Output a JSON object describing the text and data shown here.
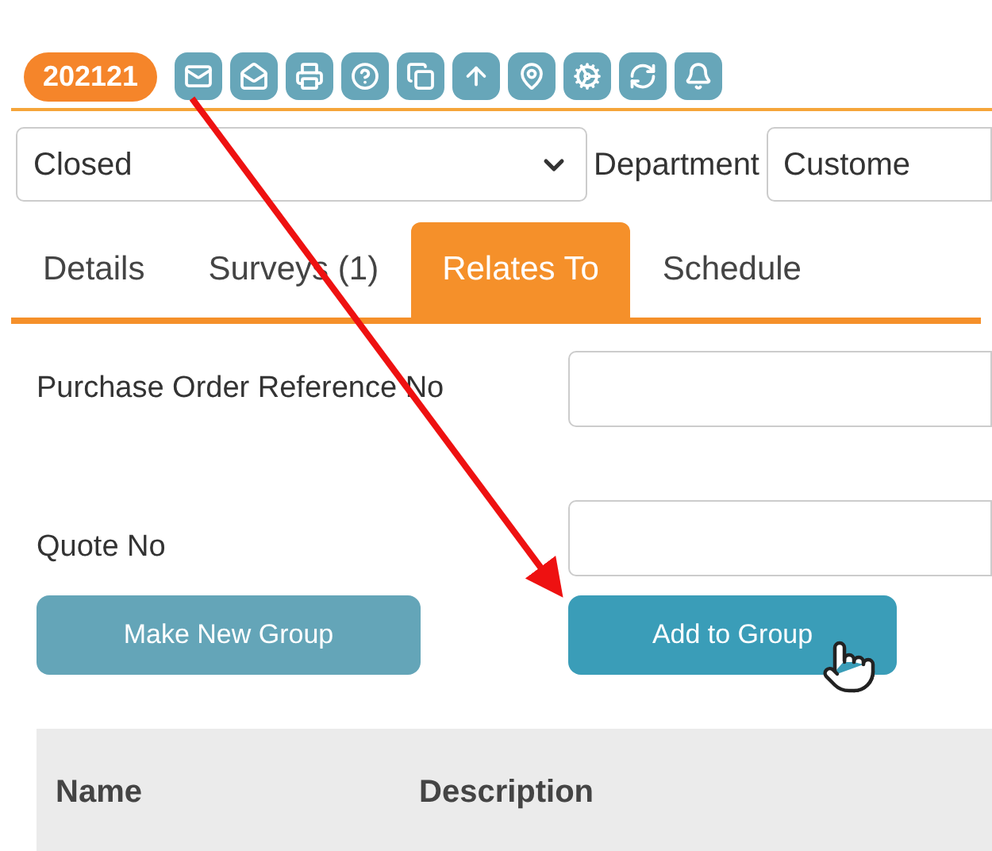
{
  "record_badge": "202121",
  "status_select": {
    "value": "Closed"
  },
  "department": {
    "label": "Department",
    "value": "Custome"
  },
  "tabs": [
    {
      "label": "Details",
      "selected": false
    },
    {
      "label": "Surveys (1)",
      "selected": false
    },
    {
      "label": "Relates To",
      "selected": true
    },
    {
      "label": "Schedule",
      "selected": false
    }
  ],
  "fields": [
    {
      "label": "Purchase Order Reference No"
    },
    {
      "label": "Quote No"
    }
  ],
  "buttons": [
    {
      "label": "Make New Group",
      "hovered": false
    },
    {
      "label": "Add to Group",
      "hovered": true
    }
  ],
  "table": {
    "columns": [
      "Name",
      "Description"
    ]
  }
}
